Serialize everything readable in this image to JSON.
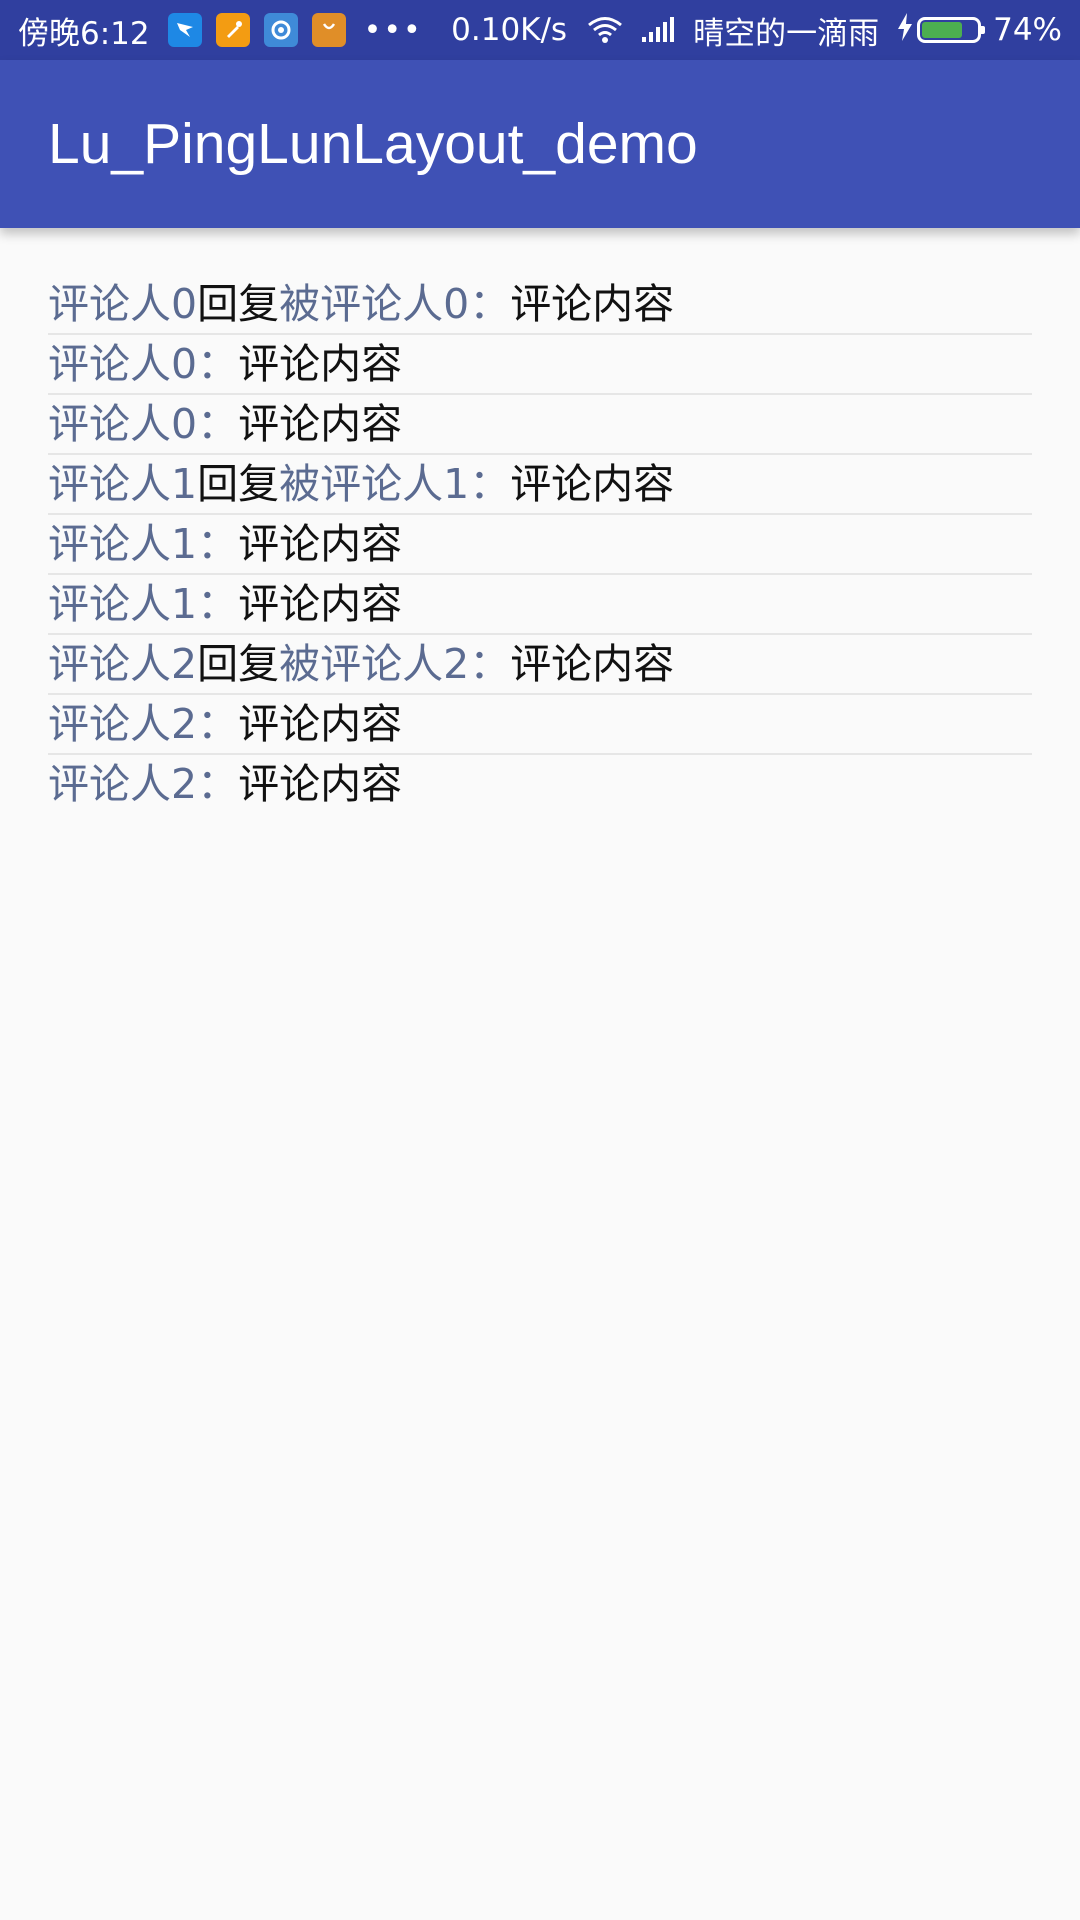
{
  "status_bar": {
    "time": "傍晚6:12",
    "speed": "0.10K/s",
    "carrier": "晴空的一滴雨",
    "battery_percent": "74%",
    "battery_level": 0.74,
    "more": "•••"
  },
  "app_bar": {
    "title": "Lu_PingLunLayout_demo"
  },
  "colors": {
    "status_bar_bg": "#303f9f",
    "app_bar_bg": "#3f51b5",
    "name_color": "#5b6b91",
    "content_color": "#111111",
    "background": "#fafafa"
  },
  "comments": [
    {
      "commenter": "评论人0",
      "reply_word": "回复",
      "target": "被评论人0",
      "colon": "：",
      "content": "评论内容"
    },
    {
      "commenter": "评论人0",
      "colon": "：",
      "content": "评论内容"
    },
    {
      "commenter": "评论人0",
      "colon": "：",
      "content": "评论内容"
    },
    {
      "commenter": "评论人1",
      "reply_word": "回复",
      "target": "被评论人1",
      "colon": "：",
      "content": "评论内容"
    },
    {
      "commenter": "评论人1",
      "colon": "：",
      "content": "评论内容"
    },
    {
      "commenter": "评论人1",
      "colon": "：",
      "content": "评论内容"
    },
    {
      "commenter": "评论人2",
      "reply_word": "回复",
      "target": "被评论人2",
      "colon": "：",
      "content": "评论内容"
    },
    {
      "commenter": "评论人2",
      "colon": "：",
      "content": "评论内容"
    },
    {
      "commenter": "评论人2",
      "colon": "：",
      "content": "评论内容"
    }
  ]
}
